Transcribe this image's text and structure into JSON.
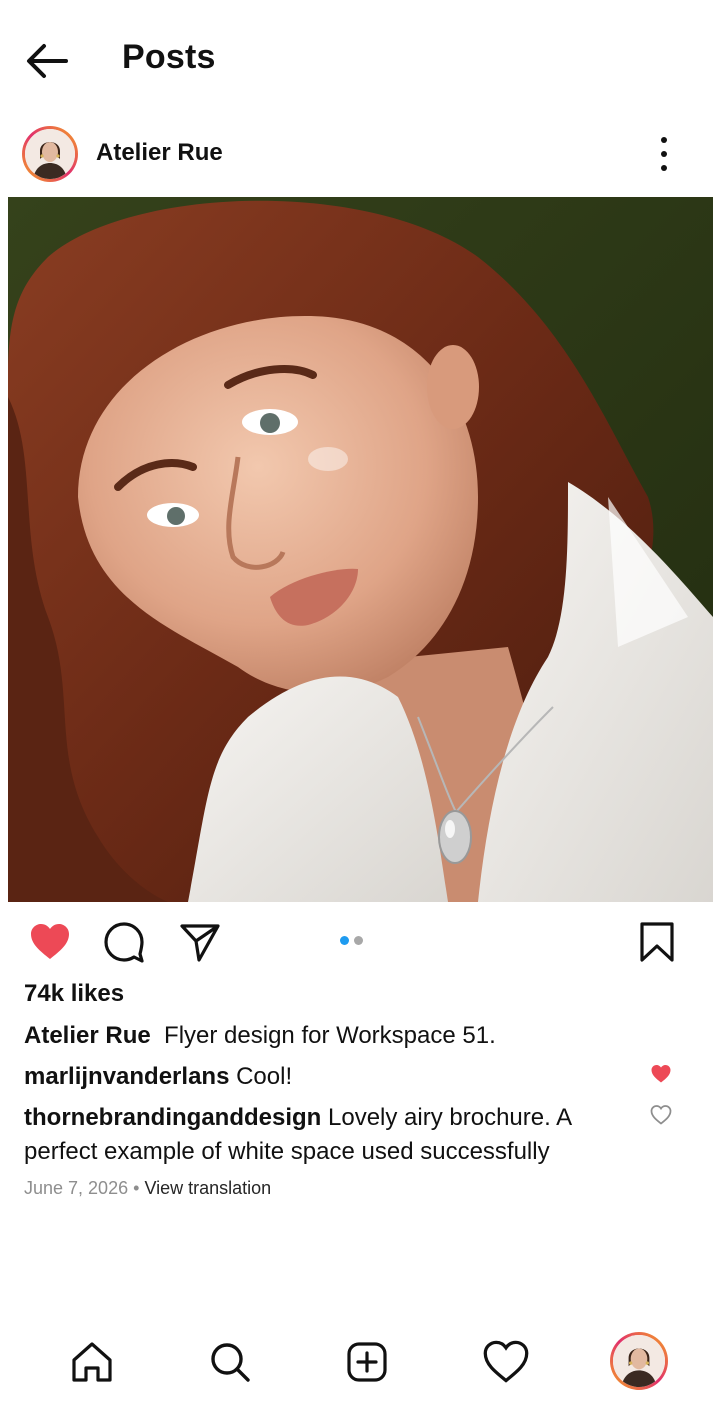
{
  "header": {
    "title": "Posts",
    "back_icon": "arrow-left-icon"
  },
  "post": {
    "author": "Atelier Rue",
    "avatar_icon": "profile-avatar",
    "more_icon": "more-vertical-icon",
    "image": "Portrait photo of a woman with wavy auburn hair wearing a white jacket and a silver pendant necklace",
    "liked": true,
    "carousel": {
      "current": 1,
      "total": 2
    },
    "likes_text": "74k likes",
    "caption": {
      "author": "Atelier Rue",
      "text": "Flyer design for Workspace 51."
    },
    "comments": [
      {
        "author": "marlijnvanderlans",
        "text": "Cool!",
        "liked": true
      },
      {
        "author": "thornebrandinganddesign",
        "text": "Lovely airy brochure. A perfect example of white space used successfully",
        "liked": false
      }
    ],
    "date": "June 7, 2026",
    "separator": "•",
    "view_translation": "View translation"
  },
  "bottom_nav": [
    "home-icon",
    "search-icon",
    "create-icon",
    "activity-heart-icon",
    "profile-avatar"
  ],
  "colors": {
    "like_red": "#ed4956",
    "active_dot": "#1e9bf0",
    "inactive_dot": "#a8a8a8",
    "muted_text": "#8e8e8e",
    "photo_bg": "#2e3a16"
  }
}
